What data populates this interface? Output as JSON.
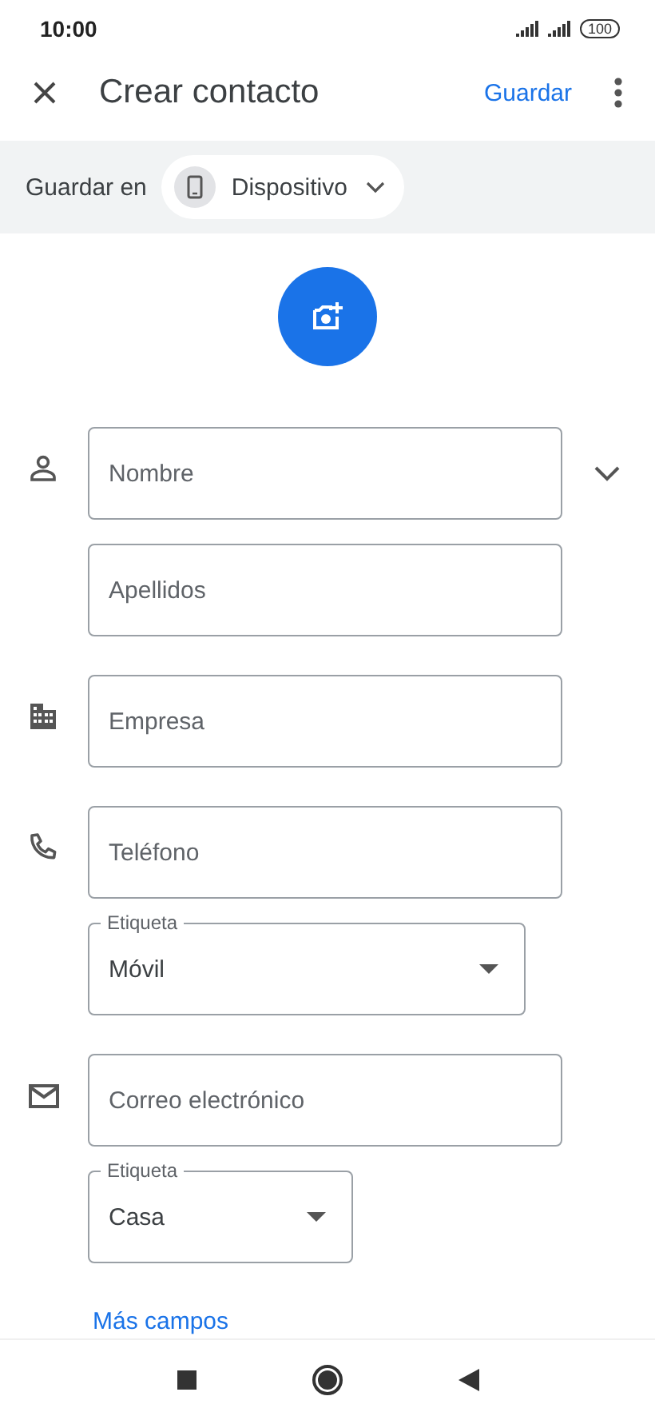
{
  "status_bar": {
    "time": "10:00",
    "battery": "100"
  },
  "toolbar": {
    "title": "Crear contacto",
    "save": "Guardar"
  },
  "save_to": {
    "label": "Guardar en",
    "account": "Dispositivo"
  },
  "sections": [
    {
      "kind": "name",
      "fields": [
        {
          "kind": "text",
          "placeholder": "Nombre"
        },
        {
          "kind": "text",
          "placeholder": "Apellidos"
        }
      ]
    },
    {
      "kind": "company",
      "fields": [
        {
          "kind": "text",
          "placeholder": "Empresa"
        }
      ]
    },
    {
      "kind": "phone",
      "fields": [
        {
          "kind": "text",
          "placeholder": "Teléfono"
        },
        {
          "kind": "select",
          "label": "Etiqueta",
          "value": "Móvil"
        }
      ]
    },
    {
      "kind": "email",
      "fields": [
        {
          "kind": "text",
          "placeholder": "Correo electrónico"
        },
        {
          "kind": "select",
          "label": "Etiqueta",
          "value": "Casa"
        }
      ]
    }
  ],
  "more_fields": "Más campos"
}
